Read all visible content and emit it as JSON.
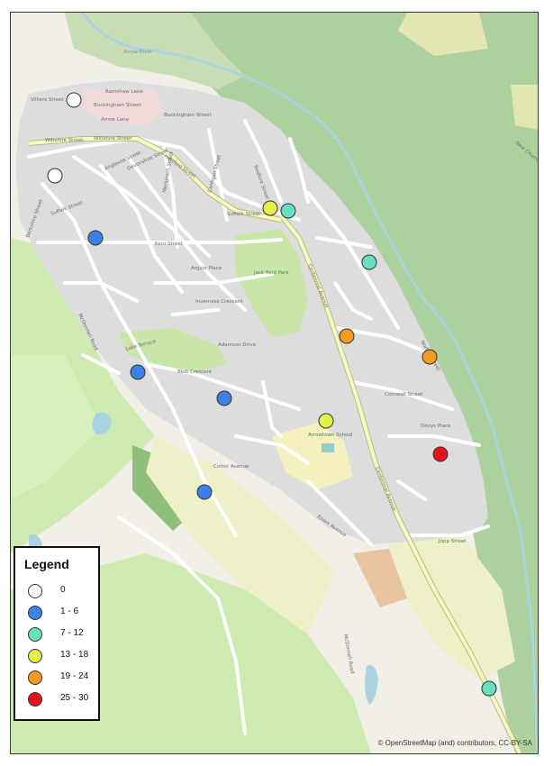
{
  "map": {
    "street_labels": {
      "arrow_river": "Arrow River",
      "ramshaw_lane": "Ramshaw Lane",
      "villiers_street": "Villiers Street",
      "buckingham_street_1": "Buckingham Street",
      "buckingham_street_2": "Buckingham Street",
      "arrow_lane": "Arrow Lane",
      "wiltshire_street": "Wiltshire Street",
      "berkshire_street": "Berkshire Street",
      "hertford_street": "Hertford Street",
      "suffolk_street": "Suffolk Street",
      "kent_street": "Kent Street",
      "anglesea_street": "Anglesea Street",
      "devonshire_street": "Devonshire Street",
      "merioneth_street": "Merioneth Street",
      "cardigan_street": "Cardigan Street",
      "bedford_street": "Bedford Street",
      "norfolk_street": "Norfolk Street",
      "centennial_avenue": "Centennial Avenue",
      "inverness_crescent": "Inverness Crescent",
      "argyle_place": "Argyle Place",
      "jack_reid_park": "Jack Reid Park",
      "lake_terrace": "Lake Terrace",
      "bedi_crescent": "Bedi Crescent",
      "cornwall_street": "Cornwall Street",
      "davys_place": "Davys Place",
      "cotter_avenue": "Cotter Avenue",
      "adamson_drive": "Adamson Drive",
      "jopp_street": "Jopp Street",
      "mcdonnell_road": "McDonnell Road",
      "arrowtown_school": "Arrowtown School",
      "new_chums": "New Chums",
      "essex_avenue": "Essex Avenue"
    },
    "points": [
      {
        "id": "p1",
        "class_index": 0
      },
      {
        "id": "p2",
        "class_index": 0
      },
      {
        "id": "p3",
        "class_index": 1
      },
      {
        "id": "p4",
        "class_index": 1
      },
      {
        "id": "p5",
        "class_index": 1
      },
      {
        "id": "p6",
        "class_index": 1
      },
      {
        "id": "p7",
        "class_index": 2
      },
      {
        "id": "p8",
        "class_index": 2
      },
      {
        "id": "p9",
        "class_index": 2
      },
      {
        "id": "p10",
        "class_index": 3
      },
      {
        "id": "p11",
        "class_index": 3
      },
      {
        "id": "p12",
        "class_index": 4
      },
      {
        "id": "p13",
        "class_index": 4
      },
      {
        "id": "p14",
        "class_index": 5
      }
    ]
  },
  "legend": {
    "title": "Legend",
    "classes": [
      {
        "label": "0",
        "color": "#ffffff"
      },
      {
        "label": "1 - 6",
        "color": "#3b82e6"
      },
      {
        "label": "7 - 12",
        "color": "#66e0bf"
      },
      {
        "label": "13 - 18",
        "color": "#e2f04a"
      },
      {
        "label": "19 - 24",
        "color": "#f59b1f"
      },
      {
        "label": "25 - 30",
        "color": "#e3131b"
      }
    ]
  },
  "attribution": "© OpenStreetMap (and) contributors, CC-BY-SA",
  "colors": {
    "land": "#f2efe9",
    "forest": "#add19e",
    "grass": "#cdebb0",
    "residential": "#dddddd",
    "road_major": "#f7fabf",
    "water": "#aad3df",
    "school": "#f5f0c0"
  }
}
